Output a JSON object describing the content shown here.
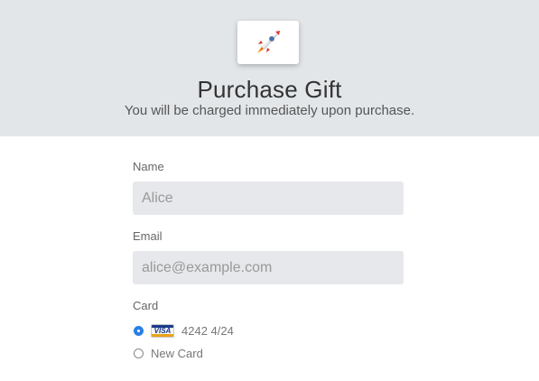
{
  "header": {
    "logo_icon": "rocket-icon",
    "title": "Purchase Gift",
    "subtitle": "You will be charged immediately upon purchase."
  },
  "form": {
    "name": {
      "label": "Name",
      "placeholder": "Alice",
      "value": ""
    },
    "email": {
      "label": "Email",
      "placeholder": "alice@example.com",
      "value": ""
    },
    "card": {
      "label": "Card",
      "options": [
        {
          "brand": "VISA",
          "text": "4242 4/24",
          "selected": true
        },
        {
          "text": "New Card",
          "selected": false
        }
      ]
    }
  },
  "colors": {
    "header_bg": "#e3e6e9",
    "input_bg": "#e6e8eb",
    "accent": "#2a7fe6"
  }
}
